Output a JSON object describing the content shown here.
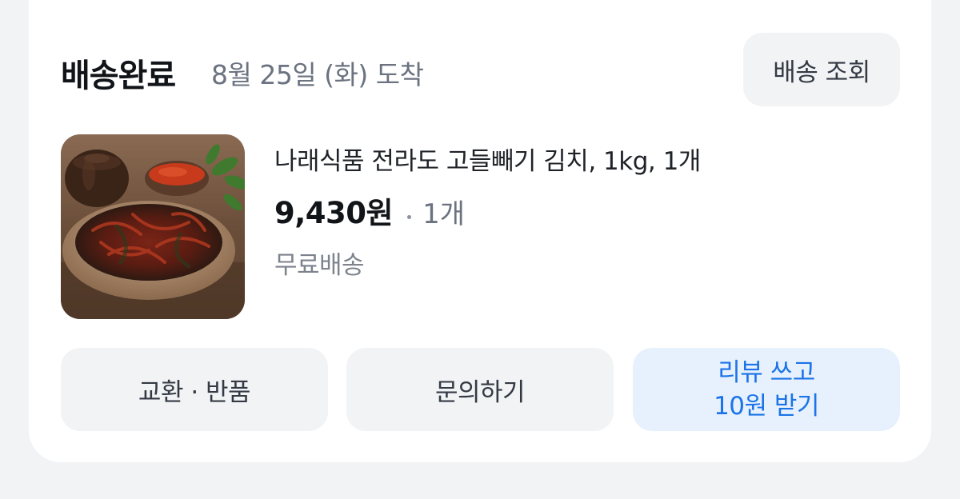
{
  "order": {
    "status": "배송완료",
    "arrival": "8월 25일 (화) 도착",
    "track_button": "배송 조회"
  },
  "product": {
    "image": "kimchi-product-photo",
    "name": "나래식품 전라도 고들빼기 김치, 1kg, 1개",
    "price": "9,430원",
    "quantity": "1개",
    "shipping": "무료배송"
  },
  "actions": {
    "exchange_return": "교환 · 반품",
    "inquiry": "문의하기",
    "review_line1": "리뷰 쓰고",
    "review_line2": "10원 받기"
  },
  "colors": {
    "accent": "#1a73e8",
    "accent_bg": "#e7f1fd",
    "button_bg": "#f2f3f5",
    "page_bg": "#f2f3f5"
  }
}
